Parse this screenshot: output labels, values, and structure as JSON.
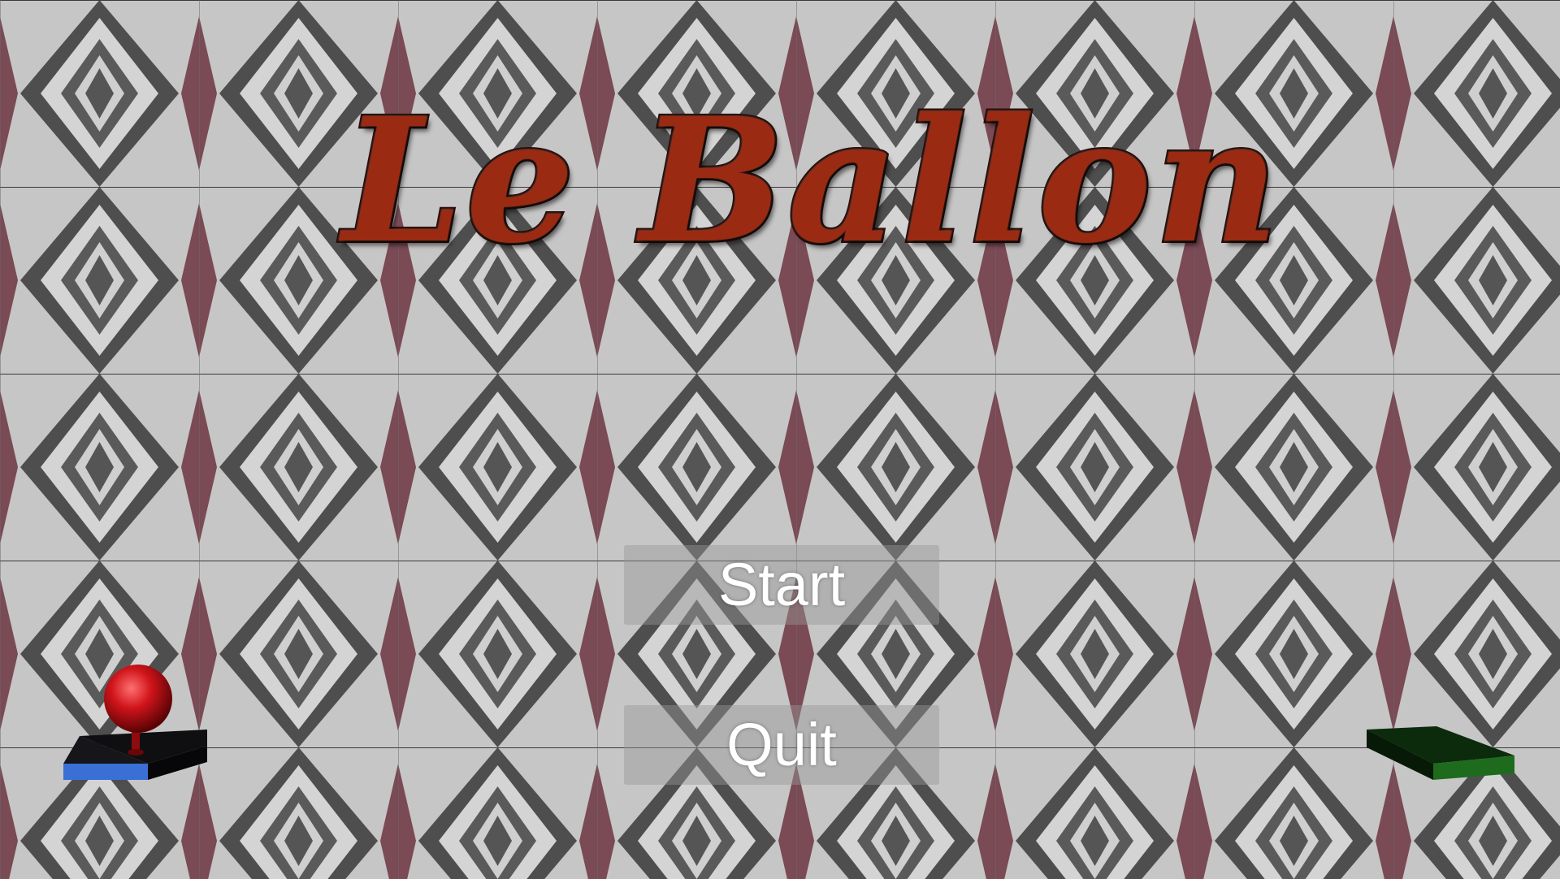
{
  "game": {
    "title": "Le Ballon"
  },
  "menu": {
    "start_label": "Start",
    "quit_label": "Quit"
  },
  "colors": {
    "title_fill": "#9a2a12",
    "title_outline": "#2a0d08",
    "tile_light": "#c9c9c9",
    "tile_dark": "#5a5a5a",
    "tile_accent": "#7a4a55",
    "ball": "#d0141a",
    "start_pad": "#3a6fd6",
    "goal_pad": "#1e6b1e",
    "button_bg": "#969696"
  },
  "scene": {
    "ball_icon": "red-ball-icon",
    "start_pad_icon": "blue-platform-icon",
    "goal_pad_icon": "green-platform-icon"
  }
}
